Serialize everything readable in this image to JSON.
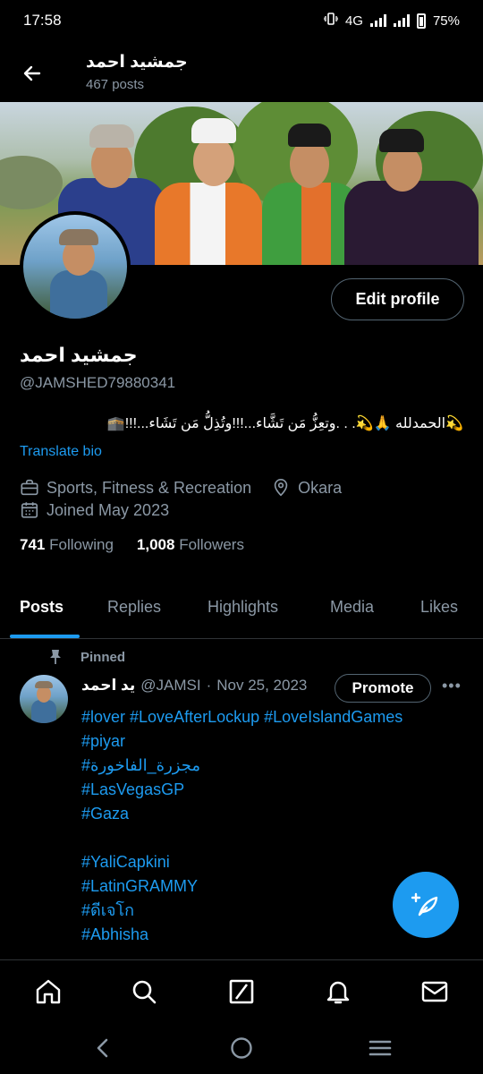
{
  "status_bar": {
    "time": "17:58",
    "network": "4G",
    "battery": "75%"
  },
  "header": {
    "name": "جمشید احمد",
    "posts_count": "467 posts"
  },
  "profile": {
    "name": "جمشید احمد",
    "handle": "@JAMSHED79880341",
    "bio": "💫الحمدلله 🙏💫. . .وتعِزُّ مَن تَشَّاء...!!!وتُذِلُّ مَن تَشَاء...!!!🕋",
    "translate_label": "Translate bio",
    "category": "Sports, Fitness & Recreation",
    "location": "Okara",
    "joined": "Joined May 2023",
    "following_count": "741",
    "following_label": "Following",
    "followers_count": "1,008",
    "followers_label": "Followers",
    "edit_button": "Edit profile"
  },
  "tabs": [
    "Posts",
    "Replies",
    "Highlights",
    "Media",
    "Likes"
  ],
  "post": {
    "pinned_label": "Pinned",
    "author_name": "ید احمد",
    "author_handle": "@JAMSI",
    "date": "Nov 25, 2023",
    "promote_label": "Promote",
    "more_label": "•••",
    "hashtags": [
      "#lover #LoveAfterLockup #LoveIslandGames",
      "#piyar",
      "#مجزرة_الفاخورة",
      "#LasVegasGP",
      "#Gaza",
      "",
      "#YaliCapkini",
      "#LatinGRAMMY",
      "#ดีเจโก",
      "#Abhisha"
    ]
  },
  "colors": {
    "accent": "#1d9bf0",
    "background": "#000000",
    "muted": "#8b98a5"
  },
  "icons": {
    "back": "arrow-left-icon",
    "category": "briefcase-icon",
    "location": "map-pin-icon",
    "joined": "calendar-icon",
    "pinned": "pin-icon",
    "fab": "compose-feather-icon",
    "nav": [
      "home-icon",
      "search-icon",
      "grok-icon",
      "notifications-icon",
      "messages-icon"
    ],
    "system": [
      "back-triangle-icon",
      "home-circle-icon",
      "recents-icon"
    ]
  }
}
